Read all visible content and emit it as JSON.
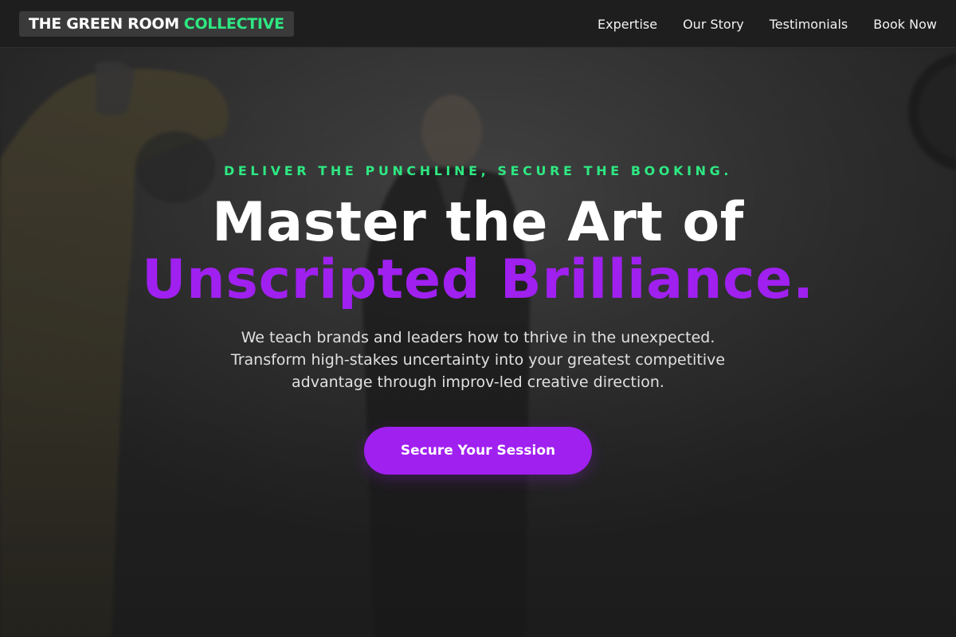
{
  "header": {
    "brand_main": "THE GREEN ROOM",
    "brand_accent": "COLLECTIVE",
    "nav": [
      {
        "label": "Expertise"
      },
      {
        "label": "Our Story"
      },
      {
        "label": "Testimonials"
      },
      {
        "label": "Book Now"
      }
    ]
  },
  "hero": {
    "eyebrow": "DELIVER THE PUNCHLINE, SECURE THE BOOKING.",
    "headline_line1": "Master the Art of",
    "headline_line2": "Unscripted Brilliance.",
    "subtext_lines": [
      "We teach brands and leaders how to thrive in the unexpected.",
      "Transform high-stakes uncertainty into your greatest competitive",
      "advantage through improv-led creative direction."
    ],
    "cta_label": "Secure Your Session"
  },
  "colors": {
    "accent_green": "#2ee882",
    "accent_purple": "#a020f0",
    "header_bg": "#1e1e1e",
    "text_white": "#ffffff"
  }
}
